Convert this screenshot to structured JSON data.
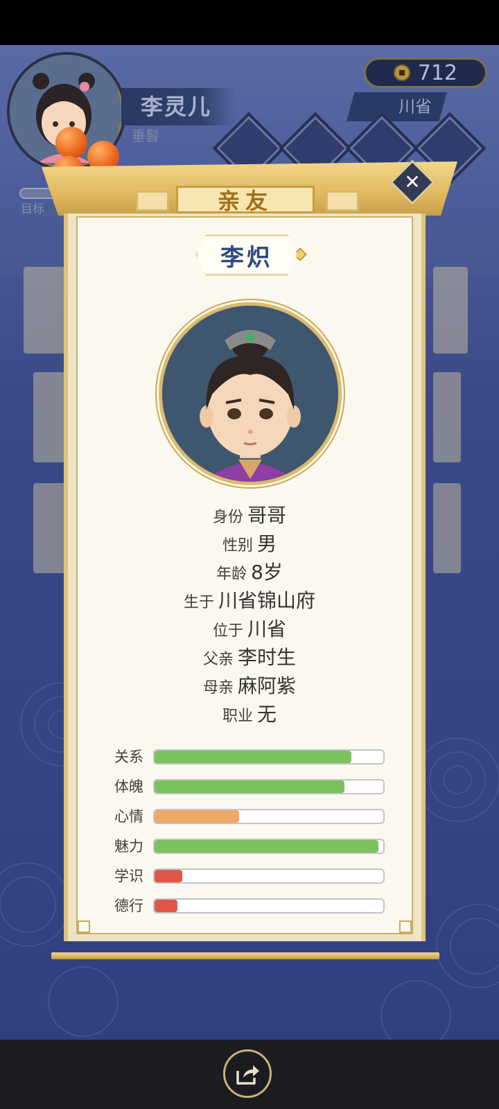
{
  "player": {
    "name": "李灵儿",
    "subtitle": "垂髫"
  },
  "currency": {
    "amount": "712",
    "icon": "copper-coin-icon"
  },
  "location": {
    "name": "川省"
  },
  "goal": {
    "label": "目标"
  },
  "dialog": {
    "title": "亲友",
    "person_name": "李炽",
    "info": [
      {
        "label": "身份",
        "value": "哥哥"
      },
      {
        "label": "性别",
        "value": "男"
      },
      {
        "label": "年龄",
        "value": "8岁"
      },
      {
        "label": "生于",
        "value": "川省锦山府"
      },
      {
        "label": "位于",
        "value": "川省"
      },
      {
        "label": "父亲",
        "value": "李时生"
      },
      {
        "label": "母亲",
        "value": "麻阿紫"
      },
      {
        "label": "职业",
        "value": "无"
      }
    ],
    "stats": [
      {
        "label": "关系",
        "value": 0.86,
        "color": "#7cc25c"
      },
      {
        "label": "体魄",
        "value": 0.83,
        "color": "#7cc25c"
      },
      {
        "label": "心情",
        "value": 0.37,
        "color": "#f0a867"
      },
      {
        "label": "魅力",
        "value": 0.98,
        "color": "#7cc25c"
      },
      {
        "label": "学识",
        "value": 0.12,
        "color": "#e0574a"
      },
      {
        "label": "德行",
        "value": 0.1,
        "color": "#e0574a"
      }
    ]
  },
  "bottom": {
    "share_icon": "share-icon"
  }
}
